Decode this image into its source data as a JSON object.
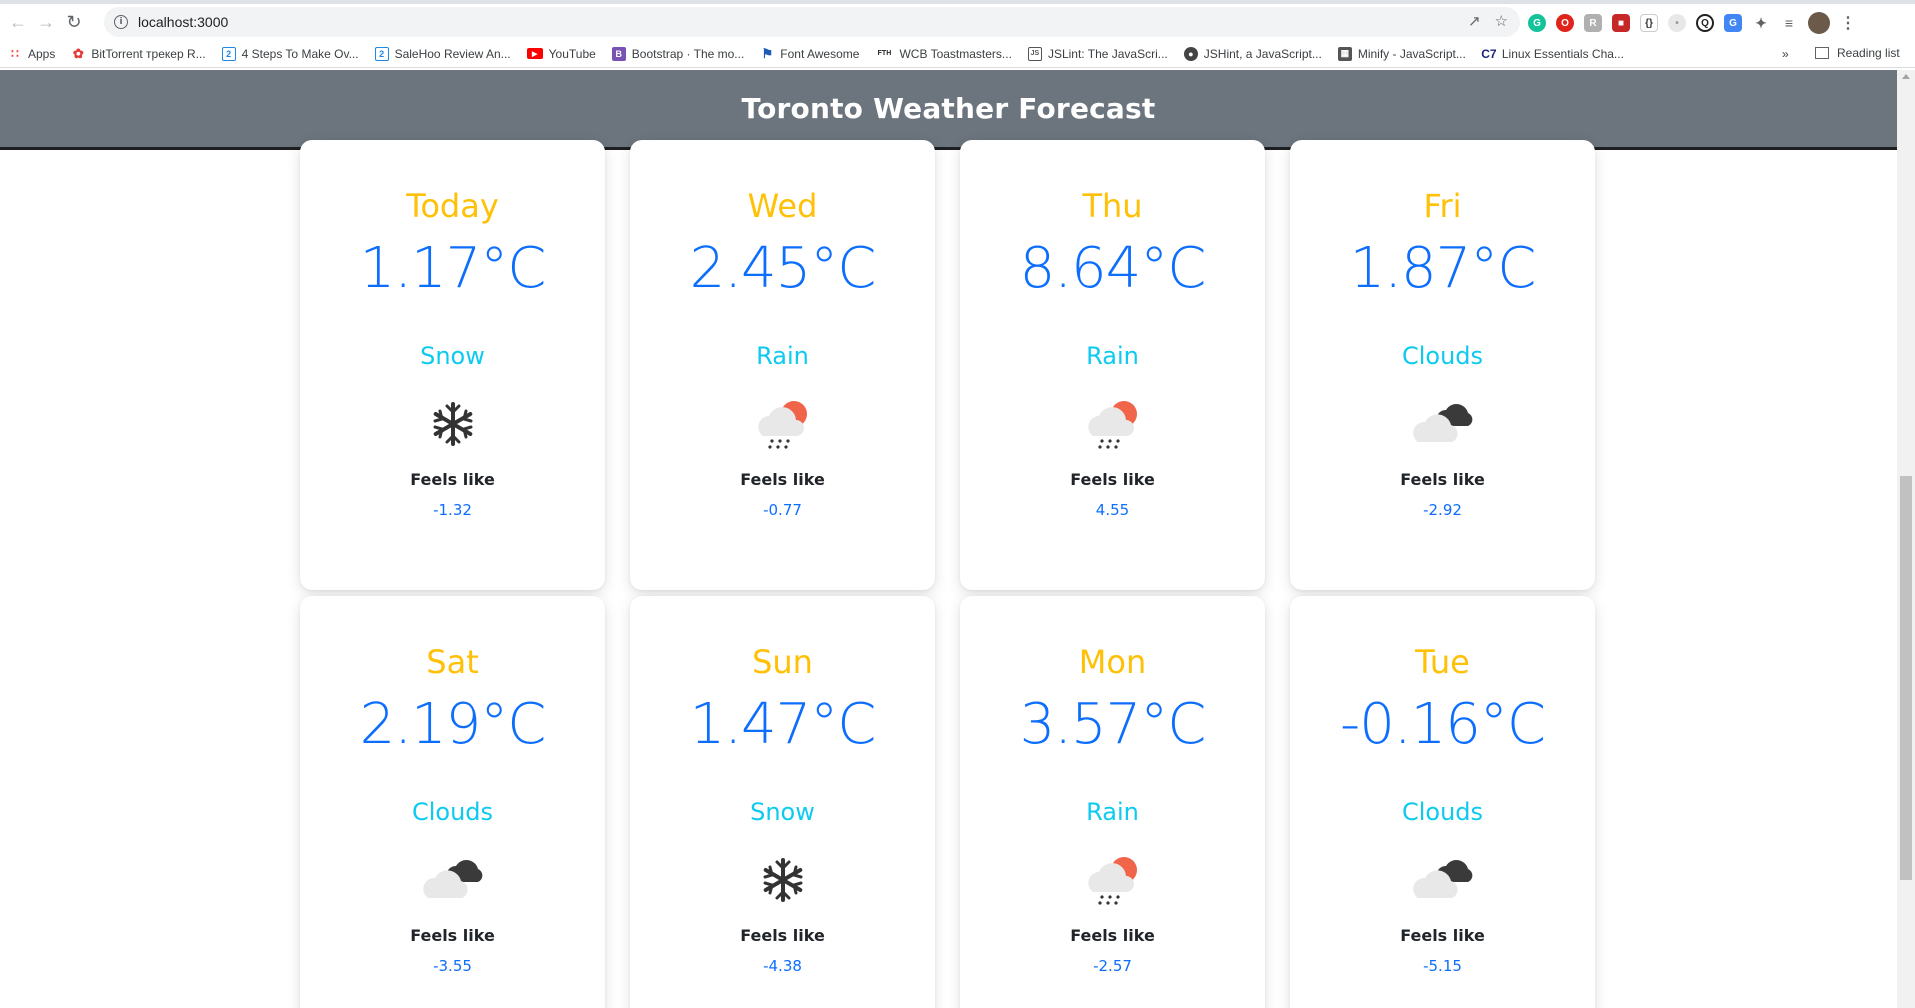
{
  "browser": {
    "url": "localhost:3000",
    "bookmarks": [
      {
        "label": "Apps",
        "icon": "apps-grid-icon",
        "color": "#ea4335"
      },
      {
        "label": "BitTorrent трекер R...",
        "icon": "torrent-icon",
        "color": "#e53935"
      },
      {
        "label": "4 Steps To Make Ov...",
        "icon": "bookmark-2-icon",
        "color": "#1e88e5"
      },
      {
        "label": "SaleHoo Review An...",
        "icon": "bookmark-2-icon",
        "color": "#1e88e5"
      },
      {
        "label": "YouTube",
        "icon": "youtube-icon",
        "color": "#ff0000"
      },
      {
        "label": "Bootstrap · The mo...",
        "icon": "bootstrap-icon",
        "color": "#7952b3"
      },
      {
        "label": "Font Awesome",
        "icon": "flag-icon",
        "color": "#1e5bb8"
      },
      {
        "label": "WCB Toastmasters...",
        "icon": "fth-icon",
        "color": "#333333"
      },
      {
        "label": "JSLint: The JavaScri...",
        "icon": "jslint-icon",
        "color": "#555555"
      },
      {
        "label": "JSHint, a JavaScript...",
        "icon": "globe-icon",
        "color": "#444444"
      },
      {
        "label": "Minify - JavaScript...",
        "icon": "minify-icon",
        "color": "#444444"
      },
      {
        "label": "Linux Essentials Cha...",
        "icon": "c7-icon",
        "color": "#1a237e"
      }
    ],
    "more": "»",
    "reading_list": "Reading list"
  },
  "page": {
    "title": "Toronto Weather Forecast"
  },
  "forecast": [
    {
      "day": "Today",
      "temp": "1.17°C",
      "condition": "Snow",
      "icon": "snowflake-icon",
      "feels_label": "Feels like",
      "feels": "-1.32"
    },
    {
      "day": "Wed",
      "temp": "2.45°C",
      "condition": "Rain",
      "icon": "rain-icon",
      "feels_label": "Feels like",
      "feels": "-0.77"
    },
    {
      "day": "Thu",
      "temp": "8.64°C",
      "condition": "Rain",
      "icon": "rain-icon",
      "feels_label": "Feels like",
      "feels": "4.55"
    },
    {
      "day": "Fri",
      "temp": "1.87°C",
      "condition": "Clouds",
      "icon": "clouds-icon",
      "feels_label": "Feels like",
      "feels": "-2.92"
    },
    {
      "day": "Sat",
      "temp": "2.19°C",
      "condition": "Clouds",
      "icon": "clouds-icon",
      "feels_label": "Feels like",
      "feels": "-3.55"
    },
    {
      "day": "Sun",
      "temp": "1.47°C",
      "condition": "Snow",
      "icon": "snowflake-icon",
      "feels_label": "Feels like",
      "feels": "-4.38"
    },
    {
      "day": "Mon",
      "temp": "3.57°C",
      "condition": "Rain",
      "icon": "rain-icon",
      "feels_label": "Feels like",
      "feels": "-2.57"
    },
    {
      "day": "Tue",
      "temp": "-0.16°C",
      "condition": "Clouds",
      "icon": "clouds-icon",
      "feels_label": "Feels like",
      "feels": "-5.15"
    }
  ],
  "colors": {
    "header_bg": "#6c757d",
    "day": "#ffc107",
    "temp": "#0d6efd",
    "condition": "#0dcaf0"
  }
}
